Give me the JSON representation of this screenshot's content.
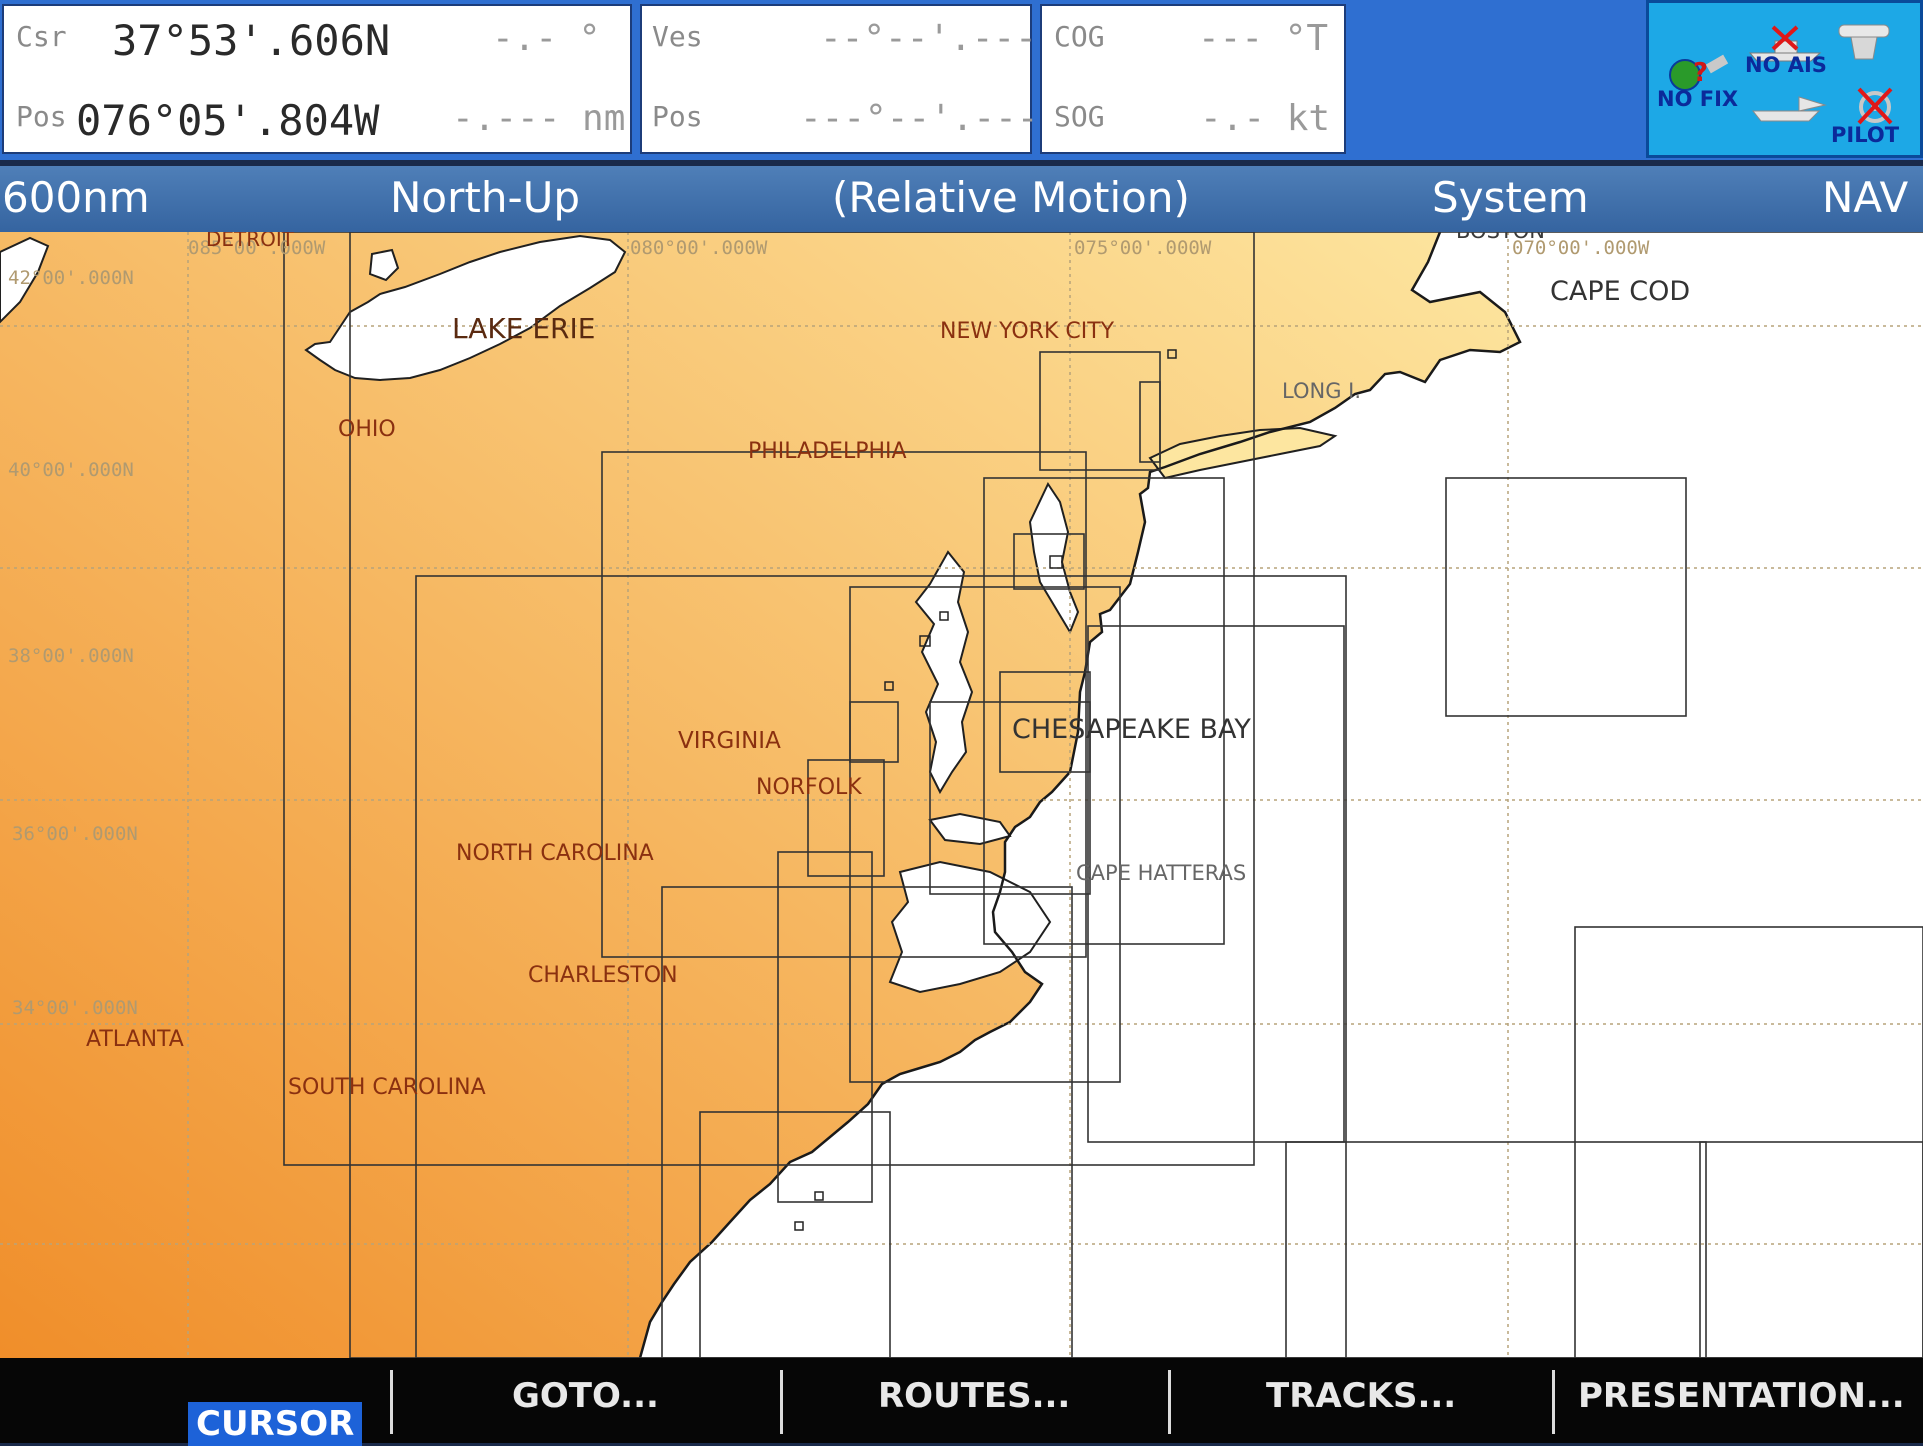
{
  "cursor": {
    "csr_label": "Csr",
    "lat": "37°53'.606N",
    "brg": "-.- °",
    "pos_label": "Pos",
    "lon": "076°05'.804W",
    "dist": "-.--- nm"
  },
  "vessel": {
    "ves_label": "Ves",
    "ves_value": "--°--'.---",
    "pos_label": "Pos",
    "pos_value": "---°--'.---"
  },
  "motion": {
    "cog_label": "COG",
    "cog_value": "--- °T",
    "sog_label": "SOG",
    "sog_value": "-.- kt"
  },
  "status": {
    "fix": "NO FIX",
    "ais": "NO AIS",
    "pilot": "PILOT"
  },
  "modebar": {
    "range": "600nm",
    "orientation": "North-Up",
    "motion": "(Relative Motion)",
    "source": "System",
    "mode": "NAV"
  },
  "chart": {
    "lon_labels": [
      "085°00'.000W",
      "080°00'.000W",
      "075°00'.000W",
      "070°00'.000W"
    ],
    "lat_labels": [
      "42°00'.000N",
      "40°00'.000N",
      "38°00'.000N",
      "36°00'.000N",
      "34°00'.000N"
    ],
    "places": {
      "detroit": "DETROIT",
      "lake_erie": "LAKE ERIE",
      "boston": "BOSTON",
      "cape_cod": "CAPE COD",
      "new_york_city": "NEW YORK CITY",
      "long_island": "LONG I.",
      "ohio": "OHIO",
      "philadelphia": "PHILADELPHIA",
      "chesapeake_bay": "CHESAPEAKE BAY",
      "virginia": "VIRGINIA",
      "norfolk": "NORFOLK",
      "north_carolina": "NORTH CAROLINA",
      "cape_hatteras": "CAPE HATTERAS",
      "charleston": "CHARLESTON",
      "atlanta": "ATLANTA",
      "south_carolina": "SOUTH CAROLINA"
    },
    "colors": {
      "land_light": "#fde6a0",
      "land_dark": "#f08e2a",
      "water": "#ffffff",
      "lake": "#ffffff",
      "grid": "#b7a37a",
      "label": "#8a3010"
    }
  },
  "softkeys": {
    "cursor": "CURSOR",
    "goto": "GOTO...",
    "routes": "ROUTES...",
    "tracks": "TRACKS...",
    "presentation": "PRESENTATION..."
  }
}
